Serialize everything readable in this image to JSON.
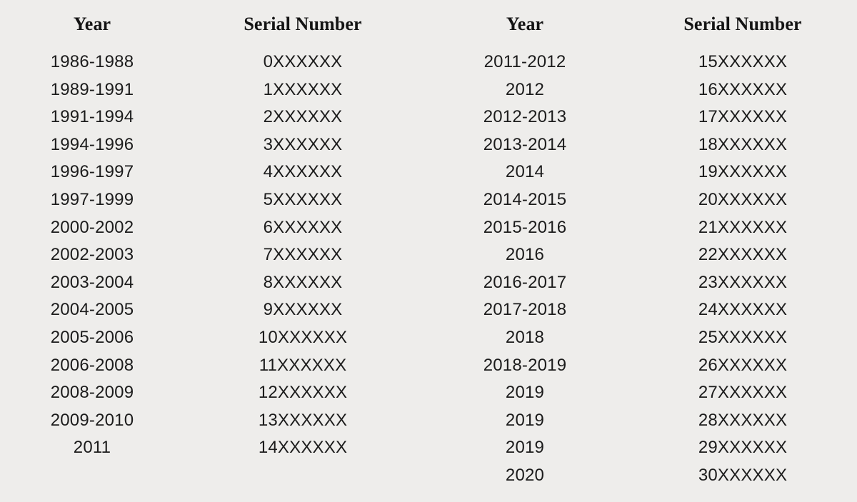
{
  "background_color": "#eeedeb",
  "text_color": "#1c1c1c",
  "header_color": "#141414",
  "tables": [
    {
      "name": "left-table",
      "headers": {
        "year": "Year",
        "serial": "Serial Number"
      },
      "rows": [
        {
          "year": "1986-1988",
          "serial": "0XXXXXX"
        },
        {
          "year": "1989-1991",
          "serial": "1XXXXXX"
        },
        {
          "year": "1991-1994",
          "serial": "2XXXXXX"
        },
        {
          "year": "1994-1996",
          "serial": "3XXXXXX"
        },
        {
          "year": "1996-1997",
          "serial": "4XXXXXX"
        },
        {
          "year": "1997-1999",
          "serial": "5XXXXXX"
        },
        {
          "year": "2000-2002",
          "serial": "6XXXXXX"
        },
        {
          "year": "2002-2003",
          "serial": "7XXXXXX"
        },
        {
          "year": "2003-2004",
          "serial": "8XXXXXX"
        },
        {
          "year": "2004-2005",
          "serial": "9XXXXXX"
        },
        {
          "year": "2005-2006",
          "serial": "10XXXXXX"
        },
        {
          "year": "2006-2008",
          "serial": "11XXXXXX"
        },
        {
          "year": "2008-2009",
          "serial": "12XXXXXX"
        },
        {
          "year": "2009-2010",
          "serial": "13XXXXXX"
        },
        {
          "year": "2011",
          "serial": "14XXXXXX"
        }
      ]
    },
    {
      "name": "right-table",
      "headers": {
        "year": "Year",
        "serial": "Serial Number"
      },
      "rows": [
        {
          "year": "2011-2012",
          "serial": "15XXXXXX"
        },
        {
          "year": "2012",
          "serial": "16XXXXXX"
        },
        {
          "year": "2012-2013",
          "serial": "17XXXXXX"
        },
        {
          "year": "2013-2014",
          "serial": "18XXXXXX"
        },
        {
          "year": "2014",
          "serial": "19XXXXXX"
        },
        {
          "year": "2014-2015",
          "serial": "20XXXXXX"
        },
        {
          "year": "2015-2016",
          "serial": "21XXXXXX"
        },
        {
          "year": "2016",
          "serial": "22XXXXXX"
        },
        {
          "year": "2016-2017",
          "serial": "23XXXXXX"
        },
        {
          "year": "2017-2018",
          "serial": "24XXXXXX"
        },
        {
          "year": "2018",
          "serial": "25XXXXXX"
        },
        {
          "year": "2018-2019",
          "serial": "26XXXXXX"
        },
        {
          "year": "2019",
          "serial": "27XXXXXX"
        },
        {
          "year": "2019",
          "serial": "28XXXXXX"
        },
        {
          "year": "2019",
          "serial": "29XXXXXX"
        },
        {
          "year": "2020",
          "serial": "30XXXXXX"
        }
      ]
    }
  ]
}
